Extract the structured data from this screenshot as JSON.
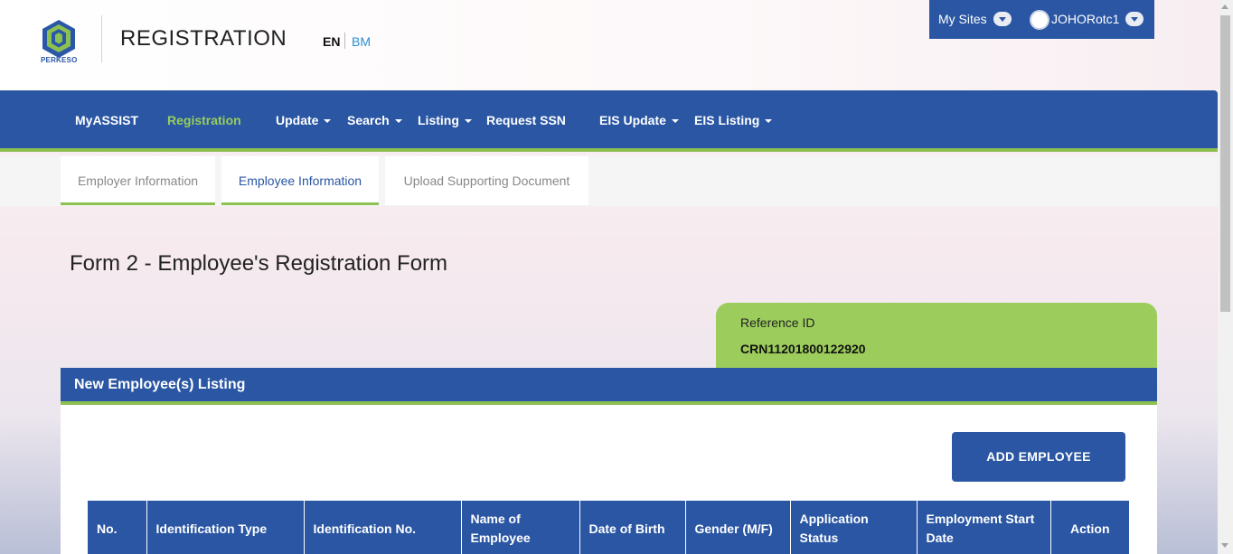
{
  "brand": {
    "logo_text": "PERKESO",
    "logo_color": "#2a57a7",
    "logo_accent": "#8cc152"
  },
  "header": {
    "title": "REGISTRATION",
    "lang_en": "EN",
    "lang_bm": "BM"
  },
  "userbar": {
    "my_sites": "My Sites",
    "username": "JOHORotc1"
  },
  "nav": {
    "items": [
      {
        "label": "MyASSIST",
        "dropdown": false,
        "active": false
      },
      {
        "label": "Registration",
        "dropdown": false,
        "active": true
      },
      {
        "label": "Update",
        "dropdown": true,
        "active": false
      },
      {
        "label": "Search",
        "dropdown": true,
        "active": false
      },
      {
        "label": "Listing",
        "dropdown": true,
        "active": false
      },
      {
        "label": "Request SSN",
        "dropdown": false,
        "active": false
      },
      {
        "label": "EIS Update",
        "dropdown": true,
        "active": false
      },
      {
        "label": "EIS Listing",
        "dropdown": true,
        "active": false
      }
    ]
  },
  "tabs": [
    {
      "label": "Employer Information",
      "state": "completed"
    },
    {
      "label": "Employee Information",
      "state": "active"
    },
    {
      "label": "Upload Supporting Document",
      "state": "inactive"
    }
  ],
  "form": {
    "title": "Form 2 - Employee's Registration Form"
  },
  "reference": {
    "label": "Reference ID",
    "value": "CRN11201800122920"
  },
  "listing": {
    "title": "New Employee(s) Listing",
    "add_button": "ADD EMPLOYEE",
    "columns": [
      "No.",
      "Identification Type",
      "Identification No.",
      "Name of Employee",
      "Date of Birth",
      "Gender (M/F)",
      "Application Status",
      "Employment Start Date",
      "Action"
    ]
  },
  "colors": {
    "primary": "#2a56a3",
    "accent_green": "#8cc152",
    "reference_green": "#9ccd5c"
  }
}
